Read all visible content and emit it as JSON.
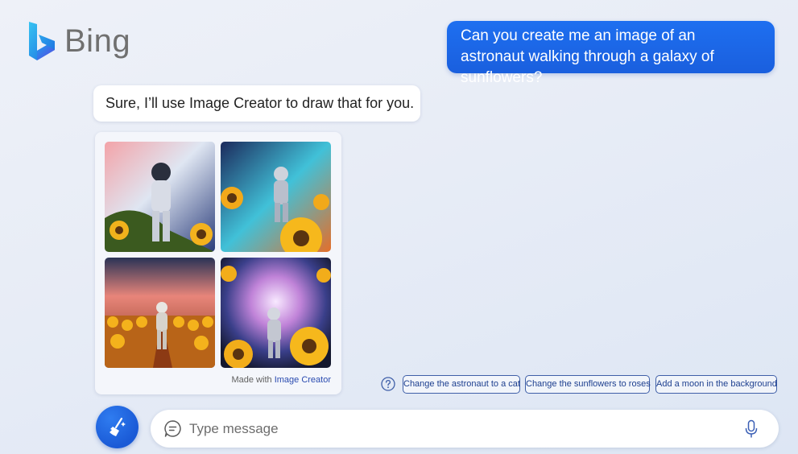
{
  "brand": {
    "name": "Bing"
  },
  "chat": {
    "user_message": "Can you create me an image of an astronaut walking through a galaxy of sunflowers?",
    "bot_message": "Sure, I’ll use Image Creator to draw that for you."
  },
  "image_card": {
    "credit_prefix": "Made with ",
    "credit_link": "Image Creator",
    "images": [
      {
        "icon": "astronaut-sunflowers-image"
      },
      {
        "icon": "astronaut-sunflowers-image"
      },
      {
        "icon": "astronaut-sunflowers-image"
      },
      {
        "icon": "astronaut-sunflowers-image"
      }
    ]
  },
  "suggestions": [
    {
      "label": "Change the astronaut to a cat"
    },
    {
      "label": "Change the sunflowers to roses"
    },
    {
      "label": "Add a moon in the background"
    }
  ],
  "composer": {
    "placeholder": "Type message",
    "value": ""
  },
  "colors": {
    "accent": "#1a5fde",
    "chip_border": "#3f5fa8",
    "link": "#2a4bb0",
    "background": "#e7ecf6"
  }
}
